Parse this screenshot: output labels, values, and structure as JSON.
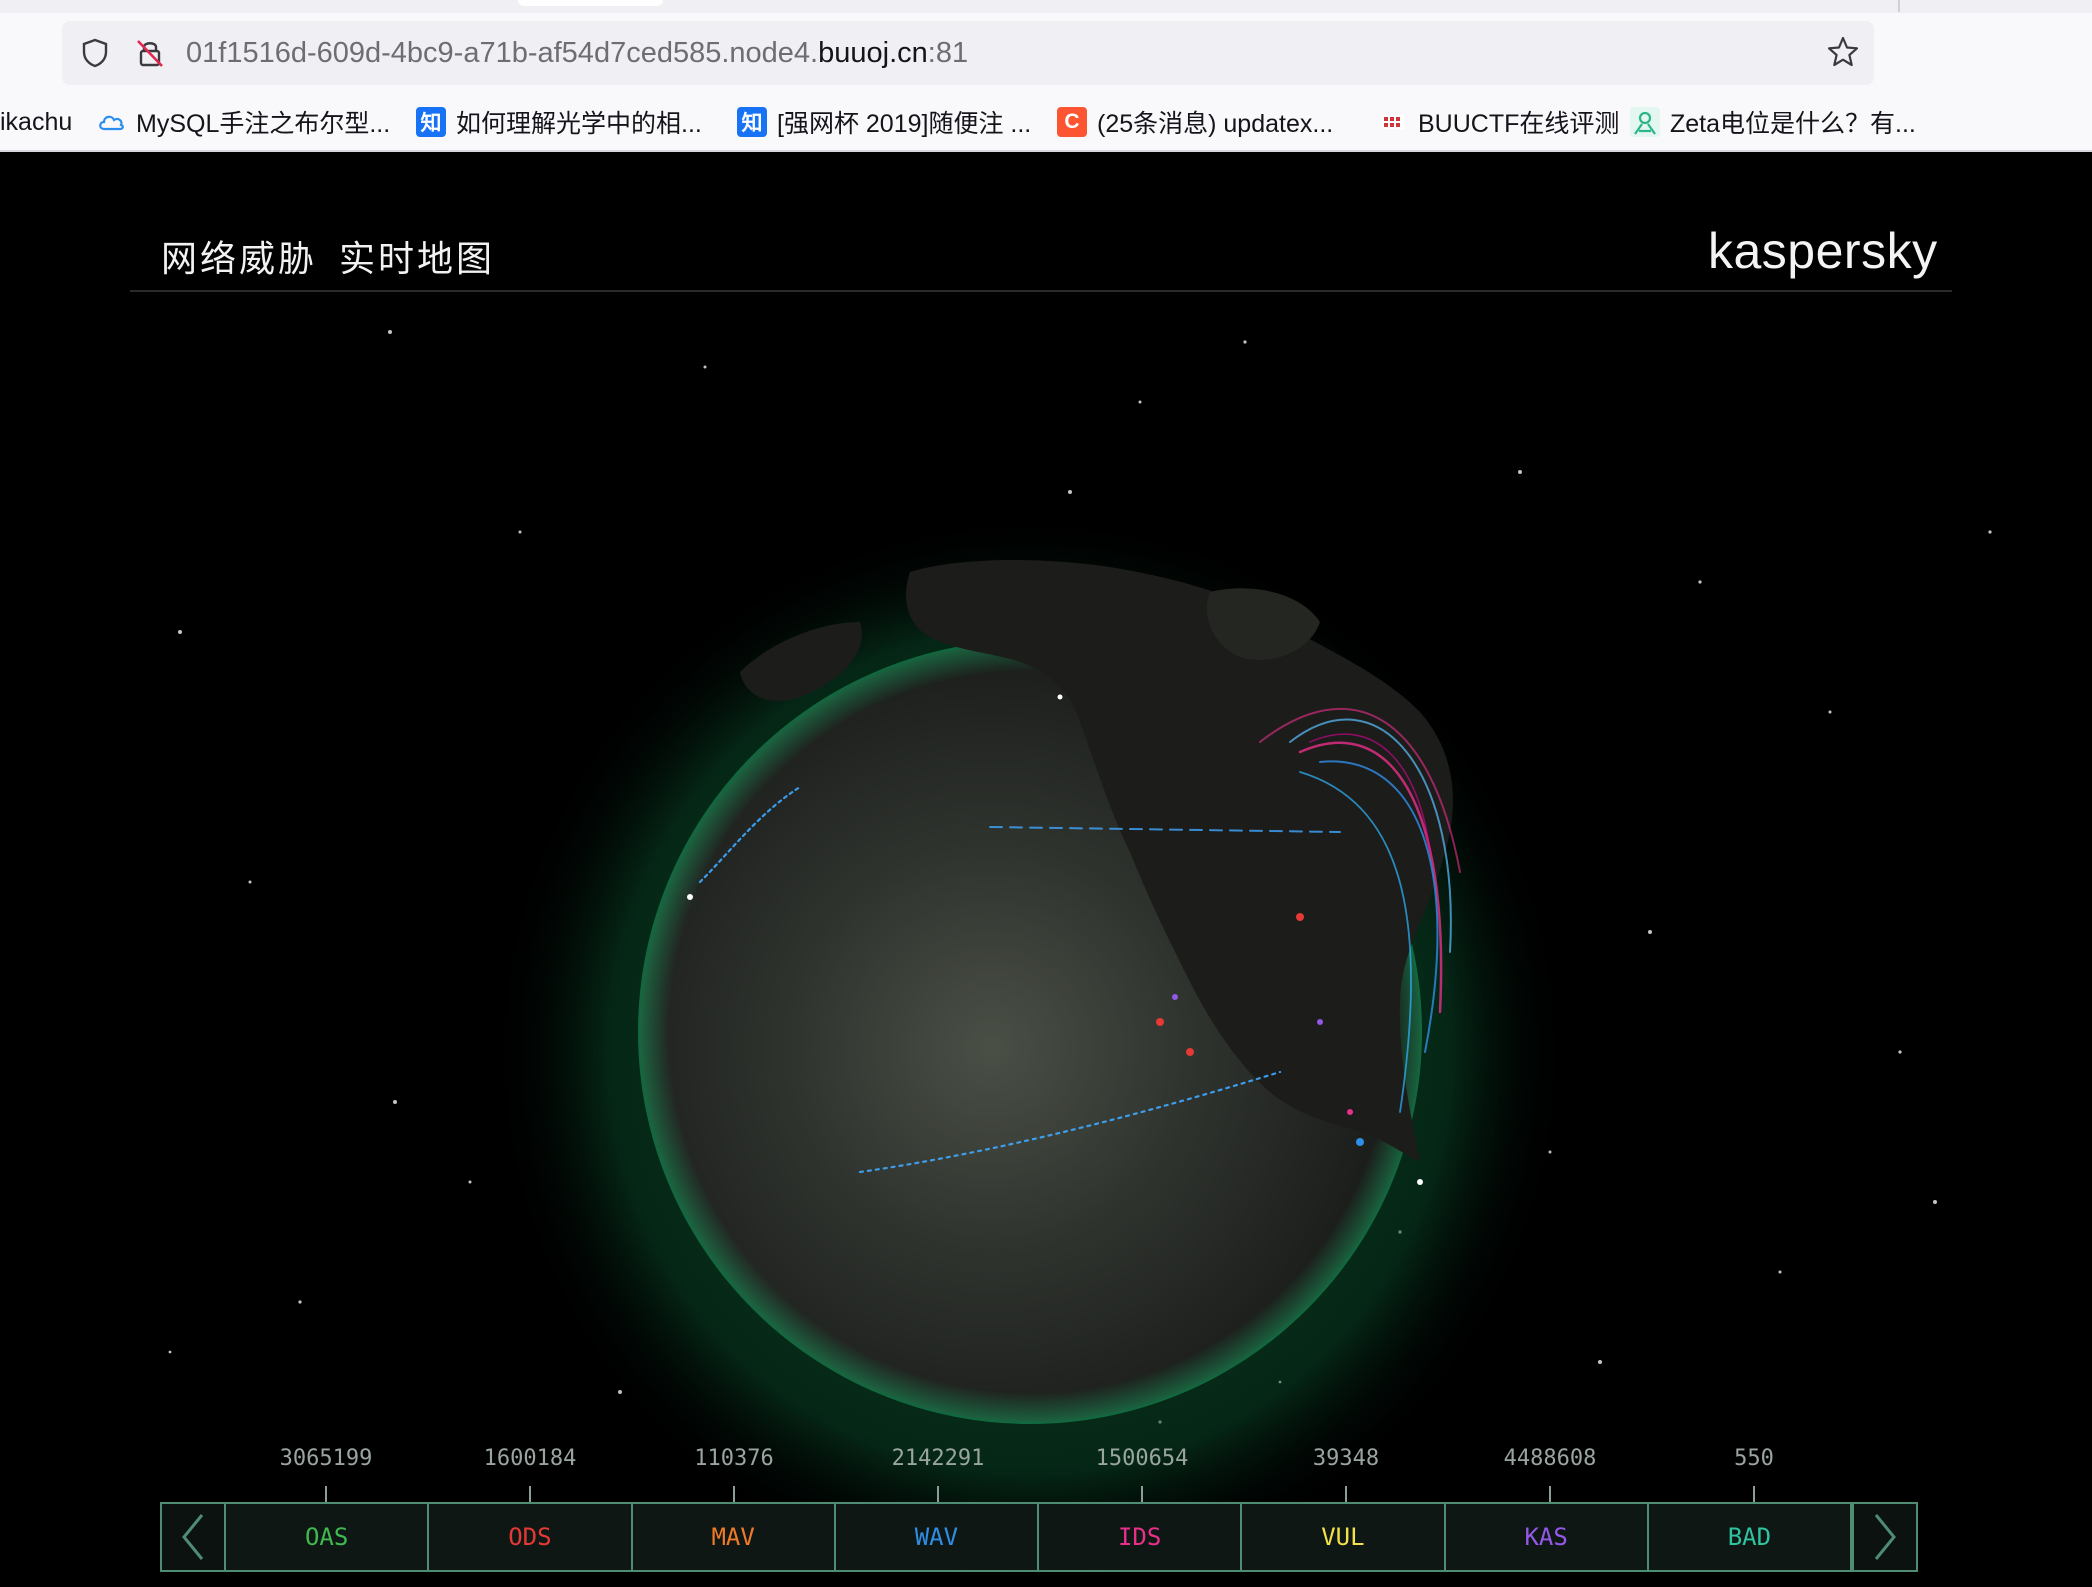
{
  "browser": {
    "url_prefix": "01f1516d-609d-4bc9-a71b-af54d7ced585.node4.",
    "url_domain": "buuoj.cn",
    "url_port": ":81",
    "bookmarks": [
      {
        "label": "ikachu",
        "icon": "none"
      },
      {
        "label": "MySQL手注之布尔型...",
        "icon": "cloud-icon"
      },
      {
        "label": "如何理解光学中的相...",
        "icon": "zhihu-icon",
        "icon_text": "知"
      },
      {
        "label": "[强网杯 2019]随便注 ...",
        "icon": "zhihu-icon",
        "icon_text": "知"
      },
      {
        "label": "(25条消息) updatex...",
        "icon": "csdn-icon",
        "icon_text": "C"
      },
      {
        "label": "BUUCTF在线评测",
        "icon": "buuctf-icon"
      },
      {
        "label": "Zeta电位是什么？有...",
        "icon": "profile-icon"
      }
    ]
  },
  "page": {
    "title": "网络威胁",
    "subtitle": "实时地图",
    "brand": "kaspersky"
  },
  "stats": [
    {
      "name": "OAS",
      "count": "3065199",
      "color": "#3fb950"
    },
    {
      "name": "ODS",
      "count": "1600184",
      "color": "#e53935"
    },
    {
      "name": "MAV",
      "count": "110376",
      "color": "#f07a28"
    },
    {
      "name": "WAV",
      "count": "2142291",
      "color": "#2f8ee6"
    },
    {
      "name": "IDS",
      "count": "1500654",
      "color": "#e8308a"
    },
    {
      "name": "VUL",
      "count": "39348",
      "color": "#f2e14a"
    },
    {
      "name": "KAS",
      "count": "4488608",
      "color": "#9458e8"
    },
    {
      "name": "BAD",
      "count": "550",
      "color": "#2ec4a0"
    }
  ],
  "colors": {
    "accent": "#4e8c74",
    "globe": "#2b2e2a",
    "glow": "#0f6a3a"
  }
}
